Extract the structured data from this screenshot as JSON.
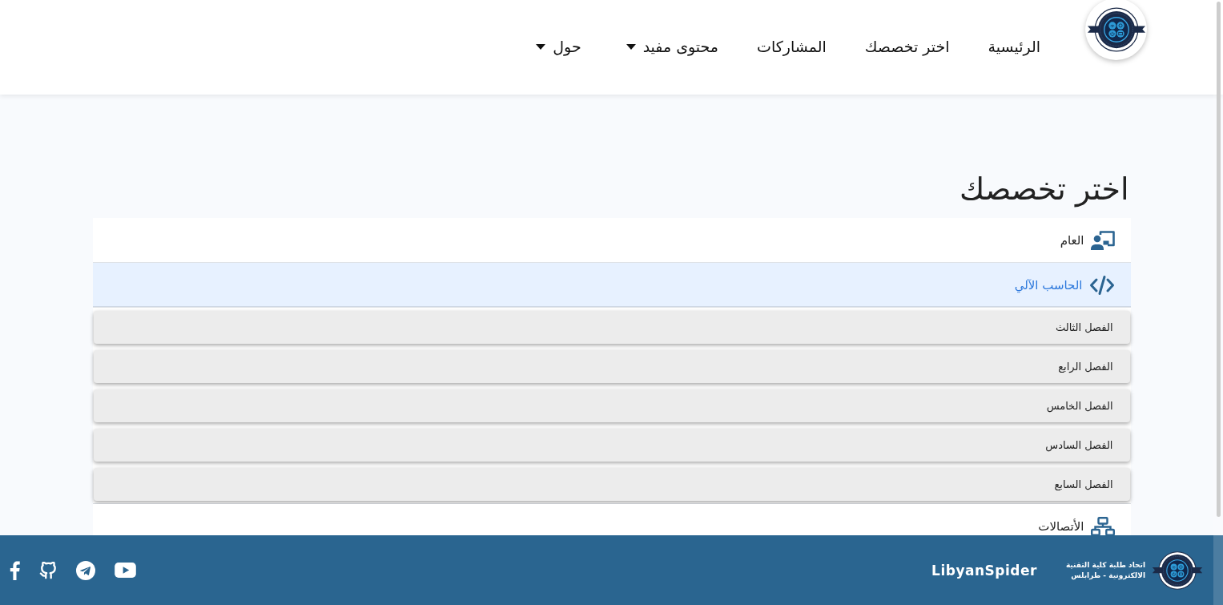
{
  "header": {
    "nav": [
      {
        "label": "الرئيسية",
        "dropdown": false
      },
      {
        "label": "اختر تخصصك",
        "dropdown": false
      },
      {
        "label": "المشاركات",
        "dropdown": false
      },
      {
        "label": "محتوى مفيد",
        "dropdown": true
      },
      {
        "label": "حول",
        "dropdown": true
      }
    ]
  },
  "page_title": "اختر تخصصك",
  "specialties": [
    {
      "kind": "presenter",
      "label": "العام",
      "expanded": false
    },
    {
      "kind": "code",
      "label": "الحاسب الآلي",
      "expanded": true,
      "children": [
        {
          "label": "الفصل الثالث"
        },
        {
          "label": "الفصل الرابع"
        },
        {
          "label": "الفصل الخامس"
        },
        {
          "label": "الفصل السادس"
        },
        {
          "label": "الفصل السابع"
        }
      ]
    },
    {
      "kind": "network",
      "label": "الأتصالات",
      "expanded": false
    }
  ],
  "footer": {
    "org_name": [
      "اتحاد طلبة كلية التقنية",
      "الالكترونية - طرابلس"
    ],
    "brand": "LibyanSpider"
  }
}
